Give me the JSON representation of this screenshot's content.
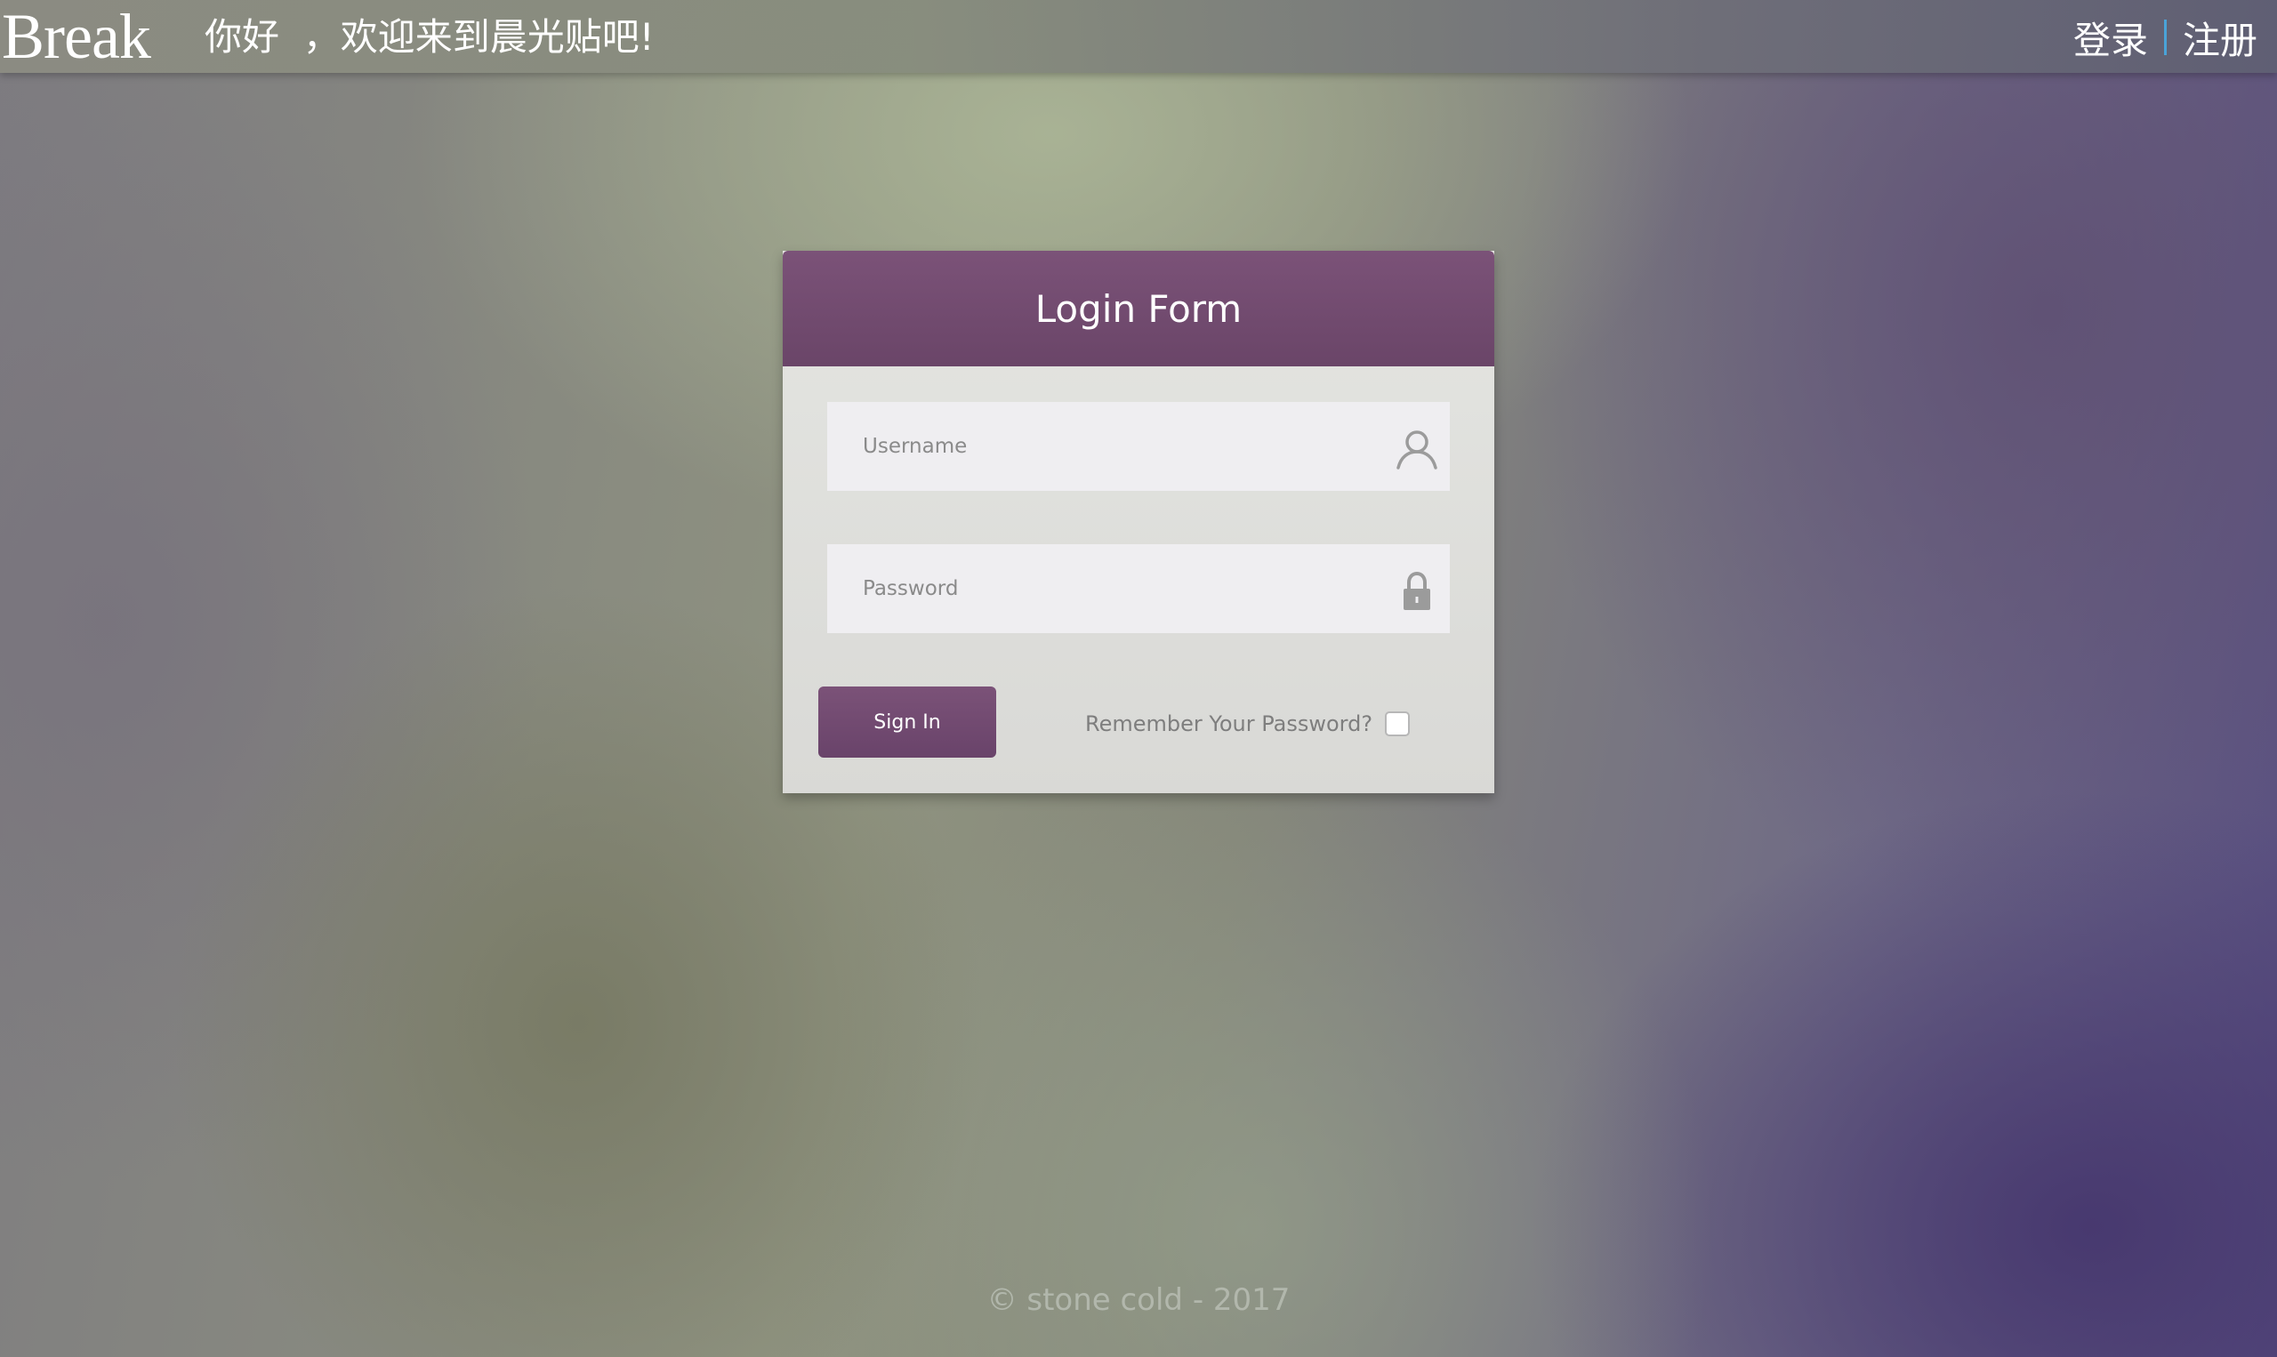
{
  "header": {
    "brand": "Break",
    "greeting": "你好  ，欢迎来到晨光贴吧!",
    "login_label": "登录",
    "register_label": "注册"
  },
  "login_form": {
    "title": "Login Form",
    "username_placeholder": "Username",
    "password_placeholder": "Password",
    "signin_label": "Sign In",
    "remember_label": "Remember Your Password?",
    "remember_checked": false
  },
  "footer": {
    "copyright": "© stone cold - 2017"
  },
  "colors": {
    "accent": "#744c72",
    "separator": "#4aa3d8"
  },
  "icons": {
    "username": "user-icon",
    "password": "lock-icon"
  }
}
